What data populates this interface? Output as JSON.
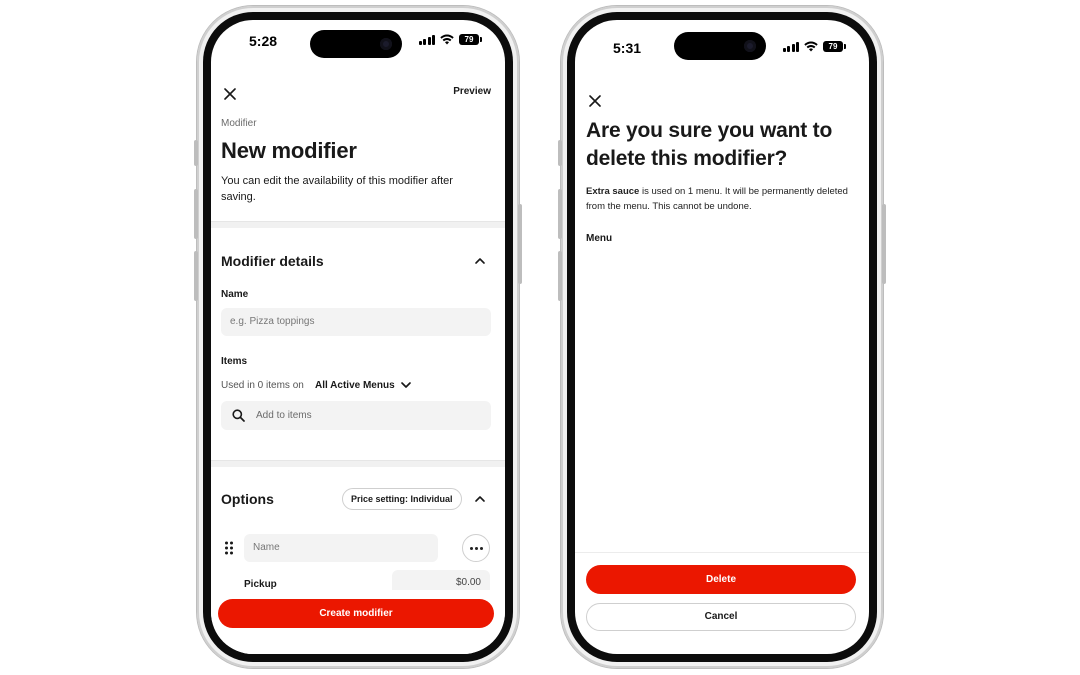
{
  "left_phone": {
    "status": {
      "time": "5:28",
      "battery": "79"
    },
    "header": {
      "close_icon": "close-icon",
      "preview_label": "Preview"
    },
    "eyebrow": "Modifier",
    "title": "New modifier",
    "subtitle": "You can edit the availability of this modifier after saving.",
    "details_section": {
      "title": "Modifier details",
      "name_label": "Name",
      "name_placeholder": "e.g. Pizza toppings",
      "items_label": "Items",
      "used_in_text": "Used in 0 items on",
      "menu_selector": "All Active Menus",
      "search_placeholder": "Add to items"
    },
    "options_section": {
      "title": "Options",
      "price_setting": "Price setting: Individual",
      "option_name_placeholder": "Name",
      "pickup_label": "Pickup",
      "pickup_price": "$0.00"
    },
    "primary_button": "Create modifier"
  },
  "right_phone": {
    "status": {
      "time": "5:31",
      "battery": "79"
    },
    "header": {
      "close_icon": "close-icon"
    },
    "title": "Are you sure you want to delete this modifier?",
    "body_bold": "Extra sauce",
    "body_rest": " is used on 1 menu. It will be permanently deleted from the menu. This cannot be undone.",
    "menu_heading": "Menu",
    "delete_button": "Delete",
    "cancel_button": "Cancel"
  },
  "colors": {
    "brand_red": "#eb1700",
    "input_bg": "#f3f3f3",
    "text": "#191919"
  }
}
